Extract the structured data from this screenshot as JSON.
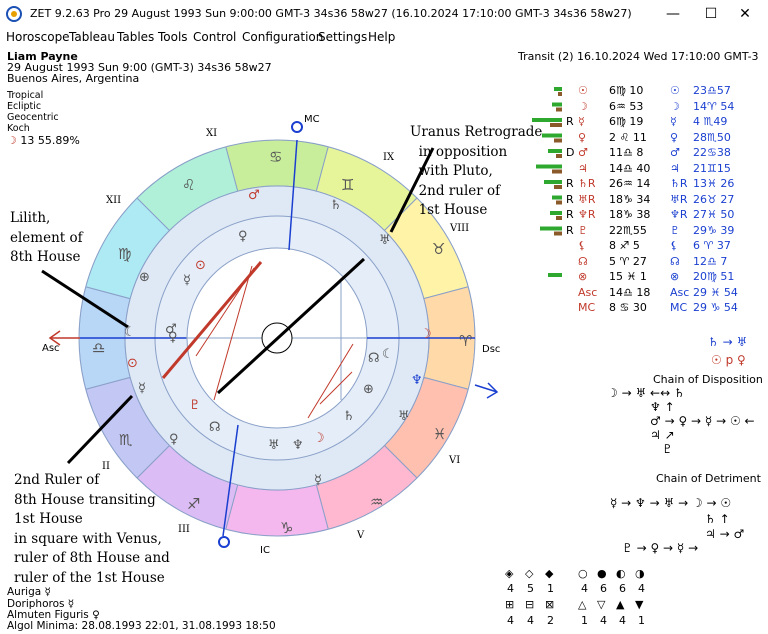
{
  "window": {
    "title": "ZET 9.2.63 Pro   29 August 1993  Sun   9:00:00 GMT-3 34s36  58w27   (16.10.2024  17:10:00 GMT-3 34s36 58w27)",
    "minimize": "—",
    "maximize": "☐",
    "close": "✕"
  },
  "menu": [
    "Horoscope",
    "Tableau",
    "Tables",
    "Tools",
    "Control",
    "Configuration",
    "Settings",
    "Help"
  ],
  "chart_info": {
    "name": "Liam Payne",
    "date_line": "29 August 1993   Sun     9:00  (GMT-3)  34s36  58w27",
    "place": "Buenos Aires, Argentina",
    "options": [
      "Tropical",
      "Ecliptic",
      "Geocentric",
      "Koch"
    ],
    "moon_phase": "13  55.89%",
    "transit_header": "Transit (2) 16.10.2024   Wed 17:10:00  GMT-3"
  },
  "annotations": {
    "uranus": "Uranus Retrograde\n  in opposition\n  with Pluto,\n  2nd ruler of\n  1st House",
    "lilith": "Lilith,\nelement of\n8th House",
    "ruler": "2nd Ruler of\n8th House transiting\n1st House\nin square with Venus,\nruler of 8th House and\nruler of the 1st House"
  },
  "wheel_labels": {
    "mc": "MC",
    "ic": "IC",
    "asc": "Asc",
    "dsc": "Dsc",
    "houses": [
      "XI",
      "XII",
      "IX",
      "VIII",
      "VI",
      "V",
      "III",
      "II"
    ]
  },
  "planets_table": [
    {
      "r": "",
      "natal": "☉",
      "npos": "6♍ 10",
      "tp": "☉",
      "tpos": "23♎57",
      "bars": [
        8,
        4
      ]
    },
    {
      "r": "",
      "natal": "☽",
      "npos": "6♒ 53",
      "tp": "☽",
      "tpos": "14♈ 54",
      "bars": [
        10,
        6
      ]
    },
    {
      "r": "R",
      "natal": "☿",
      "npos": "6♍ 19",
      "tp": "☿",
      "tpos": "4 ♏49",
      "bars": [
        30,
        12
      ]
    },
    {
      "r": "",
      "natal": "♀",
      "npos": "2 ♌ 11",
      "tp": "♀",
      "tpos": "28♏50",
      "bars": [
        20,
        8
      ]
    },
    {
      "r": "D",
      "natal": "♂",
      "npos": "11♎ 8",
      "tp": "♂",
      "tpos": "22♋38",
      "bars": [
        14,
        6
      ]
    },
    {
      "r": "",
      "natal": "♃",
      "npos": "14♎ 40",
      "tp": "♃",
      "tpos": "21♊15",
      "bars": [
        26,
        10
      ]
    },
    {
      "r": "R",
      "natal": "♄R",
      "npos": "26♒ 14",
      "tp": "♄R",
      "tpos": "13♓ 26",
      "bars": [
        18,
        8
      ]
    },
    {
      "r": "R",
      "natal": "♅R",
      "npos": "18♑ 34",
      "tp": "♅R",
      "tpos": "26♉ 27",
      "bars": [
        10,
        6
      ]
    },
    {
      "r": "R",
      "natal": "♆R",
      "npos": "18♑ 38",
      "tp": "♆R",
      "tpos": "27♓ 50",
      "bars": [
        12,
        6
      ]
    },
    {
      "r": "R",
      "natal": "♇",
      "npos": "22♏55",
      "tp": "♇",
      "tpos": "29♑ 39",
      "bars": [
        22,
        8
      ]
    },
    {
      "r": "",
      "natal": "⚸",
      "npos": "8 ♐ 5",
      "tp": "⚸",
      "tpos": "6 ♈ 37",
      "bars": [
        0,
        0
      ]
    },
    {
      "r": "",
      "natal": "☊",
      "npos": "5 ♈ 27",
      "tp": "☊",
      "tpos": "12♎  7",
      "bars": [
        0,
        0
      ]
    },
    {
      "r": "",
      "natal": "⊗",
      "npos": "15 ♓  1",
      "tp": "⊗",
      "tpos": "20♍ 51",
      "bars": [
        14,
        0
      ]
    },
    {
      "r": "",
      "natal": "Asc",
      "npos": "14♎ 18",
      "tp": "Asc",
      "tpos": "29 ♓ 54",
      "bars": [
        0,
        0
      ]
    },
    {
      "r": "",
      "natal": "MC",
      "npos": "8 ♋ 30",
      "tp": "MC",
      "tpos": "29 ♑ 54",
      "bars": [
        0,
        0
      ]
    }
  ],
  "side_extra": {
    "line1": "♄ → ♅",
    "line2": "☉ p ♀"
  },
  "chain_disposition": {
    "title": "Chain of Disposition",
    "row1": "☽ → ♅ ←↔ ♄",
    "row2": "♆ ↑",
    "row3": "♂ → ♀ → ☿ → ☉ ←",
    "row4": "♃ ↗",
    "row5": "♇"
  },
  "chain_detriment": {
    "title": "Chain of Detriment",
    "row1": "☿ → ♆ → ♅ → ☽ → ☉",
    "row2": "♄ ↑",
    "row3": "♃ → ♂",
    "row4": "♇ → ♀ → ☿ →"
  },
  "stars": [
    "Auriga  ☿",
    "Doriphoros  ☿",
    "Almuten Figuris  ♀",
    "Algol Minima: 28.08.1993 22:01,   31.08.1993 18:50"
  ],
  "element_counts": {
    "mode_icons": [
      "◈",
      "◇",
      "◆"
    ],
    "mode_vals": [
      "4",
      "5",
      "1"
    ],
    "elem_icons": [
      "○",
      "●",
      "◐",
      "◑"
    ],
    "elem_vals": [
      "4",
      "6",
      "6",
      "4"
    ],
    "quad_icons": [
      "⊞",
      "⊟",
      "⊠"
    ],
    "quad_vals": [
      "4",
      "4",
      "2"
    ],
    "tri_icons": [
      "△",
      "▽",
      "▲",
      "▼"
    ],
    "tri_vals": [
      "1",
      "4",
      "4",
      "1"
    ]
  },
  "colors": {
    "blue": "#1a3fd0",
    "red": "#c0392b",
    "green": "#2fa82f",
    "brown": "#8b5a2b"
  }
}
